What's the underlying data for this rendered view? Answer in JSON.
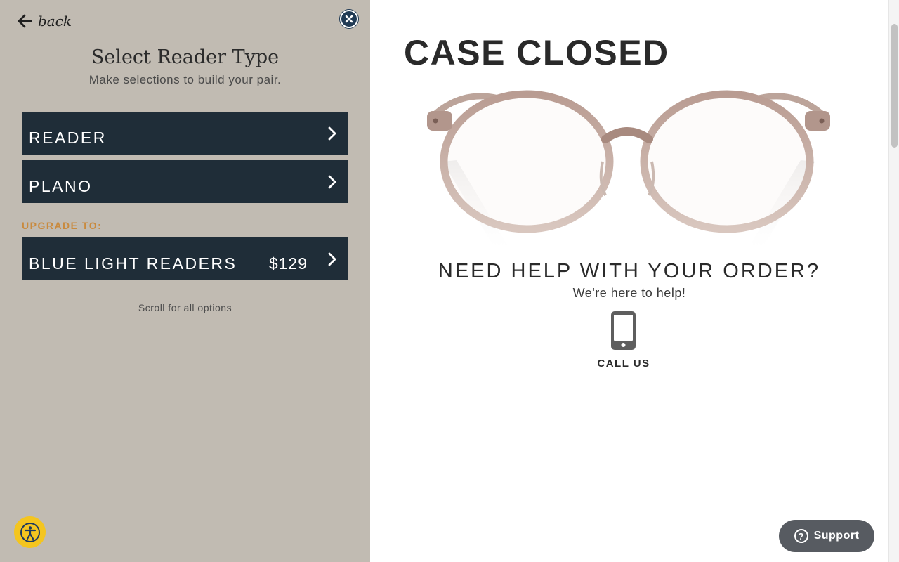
{
  "left_panel": {
    "back_label": "back",
    "title": "Select Reader Type",
    "subtitle": "Make selections to build your pair.",
    "options": [
      {
        "label": "READER",
        "price": ""
      },
      {
        "label": "PLANO",
        "price": ""
      }
    ],
    "upgrade_label": "UPGRADE TO:",
    "upgrade_option": {
      "label": "BLUE LIGHT READERS",
      "price": "$129"
    },
    "scroll_hint": "Scroll for all options"
  },
  "product": {
    "title": "CASE CLOSED",
    "image_icon": "eyeglasses-image"
  },
  "help": {
    "heading": "NEED HELP WITH YOUR ORDER?",
    "subtext": "We're here to help!",
    "call_label": "CALL US",
    "call_icon": "phone-icon"
  },
  "support_button": {
    "label": "Support",
    "icon": "question-icon"
  },
  "accessibility_button": {
    "icon": "accessibility-icon"
  },
  "colors": {
    "panel_bg": "#c1bbb2",
    "option_bg": "#1f2d38",
    "upgrade_accent": "#c98a3e",
    "close_button": "#213b55",
    "accessibility": "#f4c51f",
    "support_bg": "#575b61"
  }
}
